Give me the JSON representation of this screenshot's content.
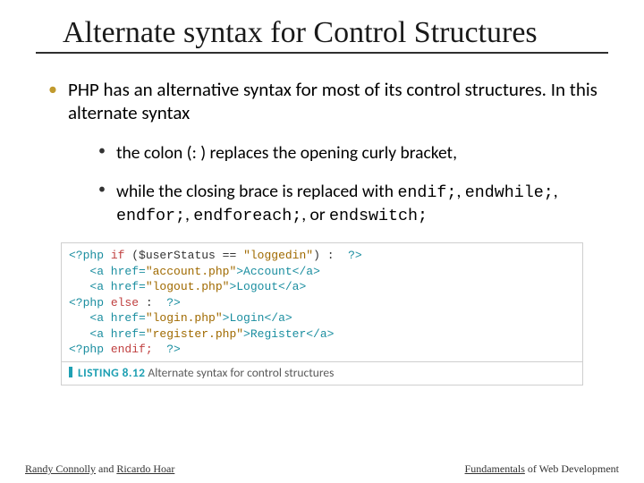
{
  "title": "Alternate syntax for Control Structures",
  "bullet1": "PHP has an alternative syntax for most of its control structures. In this alternate syntax",
  "sub1": "the colon (: ) replaces the opening curly bracket,",
  "sub2_lead": "while the closing brace is replaced with ",
  "sub2_code1": "endif;",
  "sub2_mid1": ", ",
  "sub2_code2": "endwhile;",
  "sub2_mid2": ", ",
  "sub2_code3": "endfor;",
  "sub2_mid3": ", ",
  "sub2_code4": "endforeach;",
  "sub2_mid4": ", or ",
  "sub2_code5": "endswitch;",
  "code": {
    "l1a": "<?php ",
    "l1b": "if",
    "l1c": " (",
    "l1d": "$userStatus",
    "l1e": " == ",
    "l1f": "\"loggedin\"",
    "l1g": ") :  ",
    "l1h": "?>",
    "l2a": "   <a href=",
    "l2b": "\"account.php\"",
    "l2c": ">Account</a>",
    "l3a": "   <a href=",
    "l3b": "\"logout.php\"",
    "l3c": ">Logout</a>",
    "l4a": "<?php ",
    "l4b": "else",
    "l4c": " :  ",
    "l4d": "?>",
    "l5a": "   <a href=",
    "l5b": "\"login.php\"",
    "l5c": ">Login</a>",
    "l6a": "   <a href=",
    "l6b": "\"register.php\"",
    "l6c": ">Register</a>",
    "l7a": "<?php ",
    "l7b": "endif;",
    "l7c": "  ",
    "l7d": "?>"
  },
  "listing_label": "LISTING 8.12",
  "listing_caption": " Alternate syntax for control structures",
  "footer_left_1": "Randy Connolly",
  "footer_left_2": " and ",
  "footer_left_3": "Ricardo Hoar",
  "footer_right_1": "Fundamentals",
  "footer_right_2": " of Web Development"
}
